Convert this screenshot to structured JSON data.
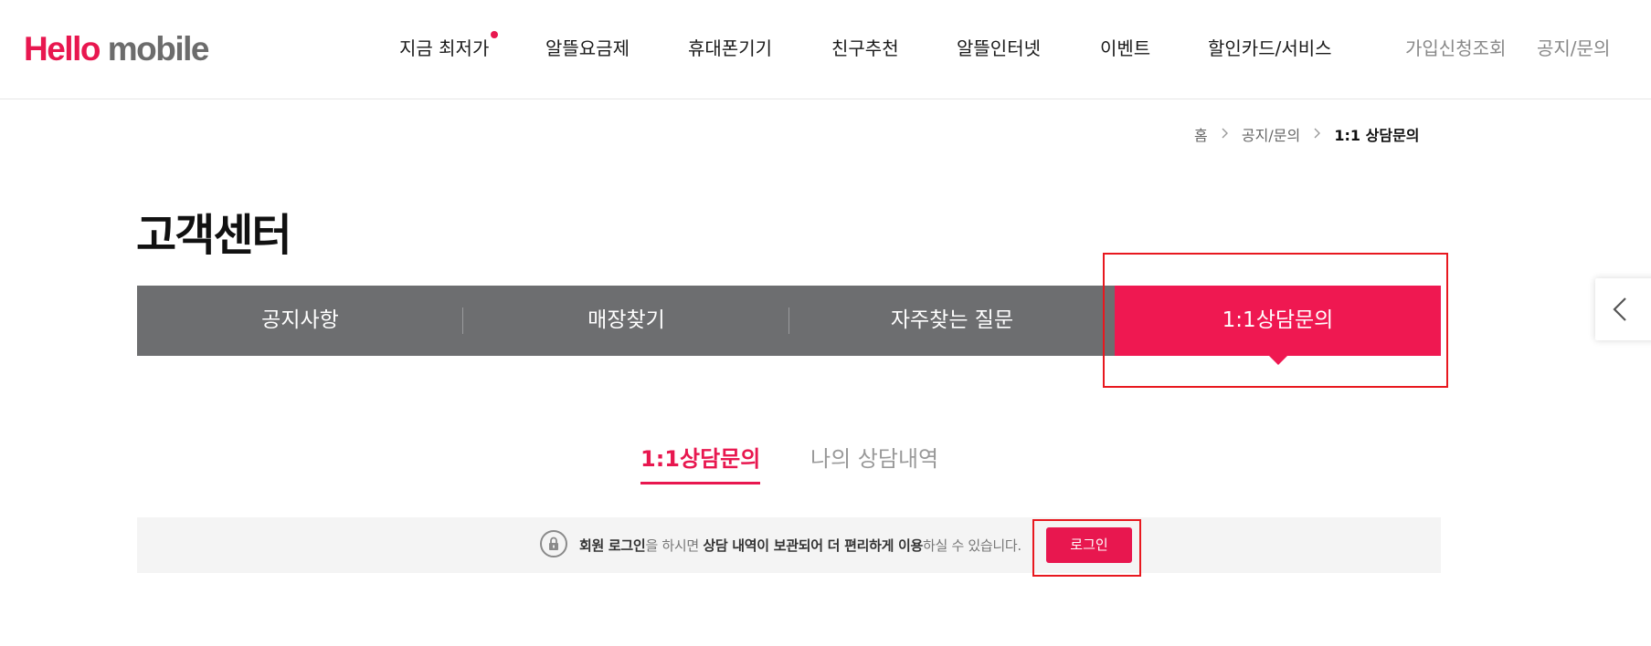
{
  "header": {
    "logo": {
      "part1": "Hello",
      "part2": "mobile"
    },
    "nav": [
      {
        "label": "지금 최저가",
        "new_badge": true
      },
      {
        "label": "알뜰요금제"
      },
      {
        "label": "휴대폰기기"
      },
      {
        "label": "친구추천"
      },
      {
        "label": "알뜰인터넷"
      },
      {
        "label": "이벤트"
      },
      {
        "label": "할인카드/서비스"
      }
    ],
    "util": [
      "가입신청조회",
      "공지/문의"
    ]
  },
  "breadcrumb": [
    "홈",
    "공지/문의",
    "1:1 상담문의"
  ],
  "page_title": "고객센터",
  "tabs": [
    {
      "label": "공지사항",
      "active": false
    },
    {
      "label": "매장찾기",
      "active": false
    },
    {
      "label": "자주찾는 질문",
      "active": false
    },
    {
      "label": "1:1상담문의",
      "active": true
    }
  ],
  "sub_tabs": [
    {
      "label": "1:1상담문의",
      "active": true
    },
    {
      "label": "나의 상담내역",
      "active": false
    }
  ],
  "notice": {
    "t1": "회원 로그인",
    "t2": "을 하시면 ",
    "t3": "상담 내역이 보관되어 더 편리하게 이용",
    "t4": "하실 수 있습니다.",
    "login_button": "로그인"
  },
  "colors": {
    "brand": "#e8174f",
    "tab_bg": "#6d6e70",
    "highlight_box": "#e8181f"
  }
}
